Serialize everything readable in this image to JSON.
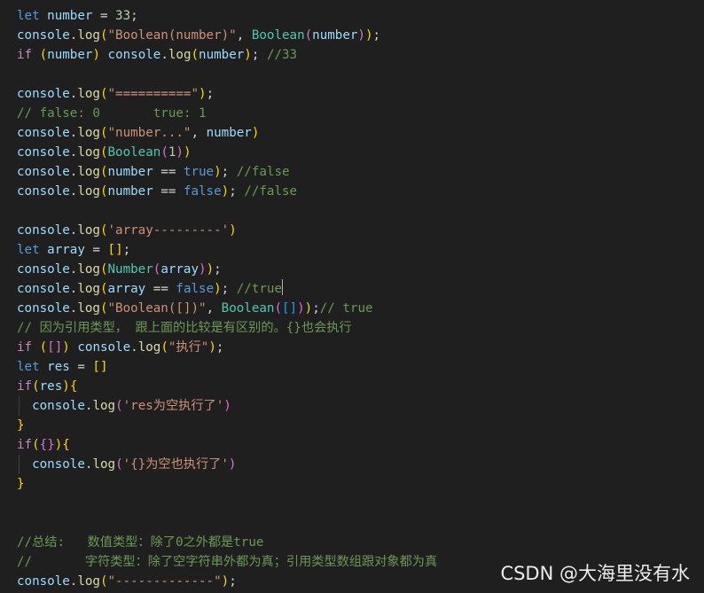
{
  "editor": {
    "background": "#1f1f1f",
    "language": "javascript",
    "cursor_line": 14,
    "lines": [
      [
        [
          "let",
          "kw"
        ],
        [
          " ",
          "plain"
        ],
        [
          "number",
          "var"
        ],
        [
          " = ",
          "plain"
        ],
        [
          "33",
          "num"
        ],
        [
          ";",
          "plain"
        ]
      ],
      [
        [
          "console",
          "var"
        ],
        [
          ".",
          "plain"
        ],
        [
          "log",
          "fn"
        ],
        [
          "(",
          "p1"
        ],
        [
          "\"Boolean(number)\"",
          "str"
        ],
        [
          ", ",
          "plain"
        ],
        [
          "Boolean",
          "cls"
        ],
        [
          "(",
          "p2"
        ],
        [
          "number",
          "var"
        ],
        [
          ")",
          "p2"
        ],
        [
          ")",
          "p1"
        ],
        [
          ";",
          "plain"
        ]
      ],
      [
        [
          "if",
          "ctl"
        ],
        [
          " ",
          "plain"
        ],
        [
          "(",
          "p1"
        ],
        [
          "number",
          "var"
        ],
        [
          ")",
          "p1"
        ],
        [
          " ",
          "plain"
        ],
        [
          "console",
          "var"
        ],
        [
          ".",
          "plain"
        ],
        [
          "log",
          "fn"
        ],
        [
          "(",
          "p1"
        ],
        [
          "number",
          "var"
        ],
        [
          ")",
          "p1"
        ],
        [
          "; ",
          "plain"
        ],
        [
          "//33",
          "cmt"
        ]
      ],
      [],
      [
        [
          "console",
          "var"
        ],
        [
          ".",
          "plain"
        ],
        [
          "log",
          "fn"
        ],
        [
          "(",
          "p1"
        ],
        [
          "\"==========\"",
          "str"
        ],
        [
          ")",
          "p1"
        ],
        [
          ";",
          "plain"
        ]
      ],
      [
        [
          "// false: 0       true: 1",
          "cmt"
        ]
      ],
      [
        [
          "console",
          "var"
        ],
        [
          ".",
          "plain"
        ],
        [
          "log",
          "fn"
        ],
        [
          "(",
          "p1"
        ],
        [
          "\"number...\"",
          "str"
        ],
        [
          ", ",
          "plain"
        ],
        [
          "number",
          "var"
        ],
        [
          ")",
          "p1"
        ]
      ],
      [
        [
          "console",
          "var"
        ],
        [
          ".",
          "plain"
        ],
        [
          "log",
          "fn"
        ],
        [
          "(",
          "p1"
        ],
        [
          "Boolean",
          "cls"
        ],
        [
          "(",
          "p2"
        ],
        [
          "1",
          "num"
        ],
        [
          ")",
          "p2"
        ],
        [
          ")",
          "p1"
        ]
      ],
      [
        [
          "console",
          "var"
        ],
        [
          ".",
          "plain"
        ],
        [
          "log",
          "fn"
        ],
        [
          "(",
          "p1"
        ],
        [
          "number",
          "var"
        ],
        [
          " == ",
          "plain"
        ],
        [
          "true",
          "kw"
        ],
        [
          ")",
          "p1"
        ],
        [
          "; ",
          "plain"
        ],
        [
          "//false",
          "cmt"
        ]
      ],
      [
        [
          "console",
          "var"
        ],
        [
          ".",
          "plain"
        ],
        [
          "log",
          "fn"
        ],
        [
          "(",
          "p1"
        ],
        [
          "number",
          "var"
        ],
        [
          " == ",
          "plain"
        ],
        [
          "false",
          "kw"
        ],
        [
          ")",
          "p1"
        ],
        [
          "; ",
          "plain"
        ],
        [
          "//false",
          "cmt"
        ]
      ],
      [],
      [
        [
          "console",
          "var"
        ],
        [
          ".",
          "plain"
        ],
        [
          "log",
          "fn"
        ],
        [
          "(",
          "p1"
        ],
        [
          "'array---------'",
          "str"
        ],
        [
          ")",
          "p1"
        ]
      ],
      [
        [
          "let",
          "kw"
        ],
        [
          " ",
          "plain"
        ],
        [
          "array",
          "var"
        ],
        [
          " = ",
          "plain"
        ],
        [
          "[",
          "p1"
        ],
        [
          "]",
          "p1"
        ],
        [
          ";",
          "plain"
        ]
      ],
      [
        [
          "console",
          "var"
        ],
        [
          ".",
          "plain"
        ],
        [
          "log",
          "fn"
        ],
        [
          "(",
          "p1"
        ],
        [
          "Number",
          "cls"
        ],
        [
          "(",
          "p2"
        ],
        [
          "array",
          "var"
        ],
        [
          ")",
          "p2"
        ],
        [
          ")",
          "p1"
        ],
        [
          ";",
          "plain"
        ]
      ],
      [
        [
          "console",
          "var"
        ],
        [
          ".",
          "plain"
        ],
        [
          "log",
          "fn"
        ],
        [
          "(",
          "p1"
        ],
        [
          "array",
          "var"
        ],
        [
          " == ",
          "plain"
        ],
        [
          "false",
          "kw"
        ],
        [
          ")",
          "p1"
        ],
        [
          "; ",
          "plain"
        ],
        [
          "//true",
          "cmt"
        ]
      ],
      [
        [
          "console",
          "var"
        ],
        [
          ".",
          "plain"
        ],
        [
          "log",
          "fn"
        ],
        [
          "(",
          "p1"
        ],
        [
          "\"Boolean([])\"",
          "str"
        ],
        [
          ", ",
          "plain"
        ],
        [
          "Boolean",
          "cls"
        ],
        [
          "(",
          "p2"
        ],
        [
          "[",
          "p3"
        ],
        [
          "]",
          "p3"
        ],
        [
          ")",
          "p2"
        ],
        [
          ")",
          "p1"
        ],
        [
          ";",
          "plain"
        ],
        [
          "// true",
          "cmt"
        ]
      ],
      [
        [
          "// 因为引用类型， 跟上面的比较是有区别的。{}也会执行",
          "cmt"
        ]
      ],
      [
        [
          "if",
          "ctl"
        ],
        [
          " ",
          "plain"
        ],
        [
          "(",
          "p1"
        ],
        [
          "[",
          "p2"
        ],
        [
          "]",
          "p2"
        ],
        [
          ")",
          "p1"
        ],
        [
          " ",
          "plain"
        ],
        [
          "console",
          "var"
        ],
        [
          ".",
          "plain"
        ],
        [
          "log",
          "fn"
        ],
        [
          "(",
          "p1"
        ],
        [
          "\"执行\"",
          "str"
        ],
        [
          ")",
          "p1"
        ],
        [
          ";",
          "plain"
        ]
      ],
      [
        [
          "let",
          "kw"
        ],
        [
          " ",
          "plain"
        ],
        [
          "res",
          "var"
        ],
        [
          " = ",
          "plain"
        ],
        [
          "[",
          "p1"
        ],
        [
          "]",
          "p1"
        ]
      ],
      [
        [
          "if",
          "ctl"
        ],
        [
          "(",
          "p1"
        ],
        [
          "res",
          "var"
        ],
        [
          ")",
          "p1"
        ],
        [
          "{",
          "p1"
        ]
      ],
      [
        [
          "  ",
          "plain"
        ],
        [
          "console",
          "var"
        ],
        [
          ".",
          "plain"
        ],
        [
          "log",
          "fn"
        ],
        [
          "(",
          "p2"
        ],
        [
          "'res为空执行了'",
          "str"
        ],
        [
          ")",
          "p2"
        ]
      ],
      [
        [
          "}",
          "p1"
        ]
      ],
      [
        [
          "if",
          "ctl"
        ],
        [
          "(",
          "p1"
        ],
        [
          "{",
          "p2"
        ],
        [
          "}",
          "p2"
        ],
        [
          ")",
          "p1"
        ],
        [
          "{",
          "p1"
        ]
      ],
      [
        [
          "  ",
          "plain"
        ],
        [
          "console",
          "var"
        ],
        [
          ".",
          "plain"
        ],
        [
          "log",
          "fn"
        ],
        [
          "(",
          "p2"
        ],
        [
          "'{}为空也执行了'",
          "str"
        ],
        [
          ")",
          "p2"
        ]
      ],
      [
        [
          "}",
          "p1"
        ]
      ],
      [],
      [],
      [
        [
          "//总结:   数值类型：除了0之外都是true",
          "cmt"
        ]
      ],
      [
        [
          "//       字符类型：除了空字符串外都为真；引用类型数组跟对象都为真",
          "cmt"
        ]
      ],
      [
        [
          "console",
          "var"
        ],
        [
          ".",
          "plain"
        ],
        [
          "log",
          "fn"
        ],
        [
          "(",
          "p1"
        ],
        [
          "\"-------------\"",
          "str"
        ],
        [
          ")",
          "p1"
        ],
        [
          ";",
          "plain"
        ]
      ]
    ],
    "indent_guide_lines": [
      20,
      23
    ]
  },
  "colors": {
    "kw": "#569cd6",
    "ctl": "#c586c0",
    "var": "#9cdcfe",
    "fn": "#dcdcaa",
    "cls": "#4ec9b0",
    "str": "#ce9178",
    "num": "#b5cea8",
    "cmt": "#6a9955",
    "plain": "#d4d4d4",
    "p1": "#ffd700",
    "p2": "#da70d6",
    "p3": "#179fff"
  },
  "watermark": {
    "text": "CSDN @大海里没有水"
  }
}
